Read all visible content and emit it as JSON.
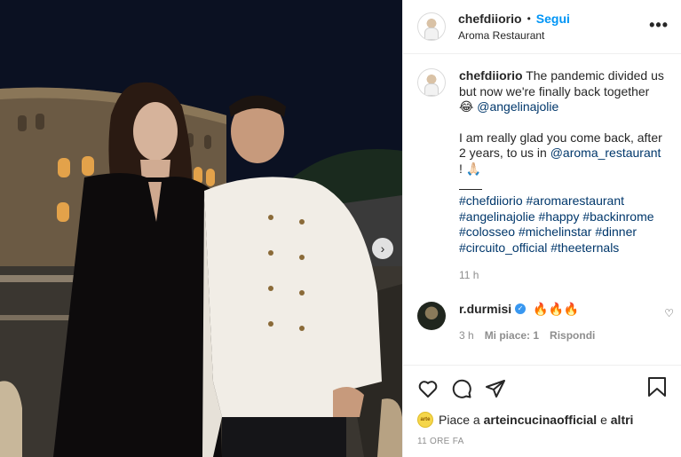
{
  "header": {
    "username": "chefdiiorio",
    "separator": "•",
    "follow_label": "Segui",
    "location": "Aroma Restaurant",
    "more_icon": "more-horizontal-icon"
  },
  "caption": {
    "username": "chefdiiorio",
    "text_1": "The pandemic divided us but now we're finally back together 😂",
    "mention_1": "@angelinajolie",
    "text_2": "I am really glad you come back, after 2 years, to us in",
    "mention_2": "@aroma_restaurant",
    "text_3": "! 🙏🏻",
    "hashtags": [
      "#chefdiiorio",
      "#aromarestaurant",
      "#angelinajolie",
      "#happy",
      "#backinrome",
      "#colosseo",
      "#michelinstar",
      "#dinner",
      "#circuito_official",
      "#theeternals"
    ],
    "time": "11 h"
  },
  "comment": {
    "username": "r.durmisi",
    "text": "🔥🔥🔥",
    "time": "3 h",
    "likes": "Mi piace: 1",
    "reply_label": "Rispondi"
  },
  "likes": {
    "prefix": "Piace a",
    "user": "arteincucinaofficial",
    "conj": "e",
    "others": "altri",
    "ago": "11 ORE FA"
  },
  "colors": {
    "link": "#00376b",
    "follow": "#0095f6",
    "muted": "#8e8e8e"
  }
}
